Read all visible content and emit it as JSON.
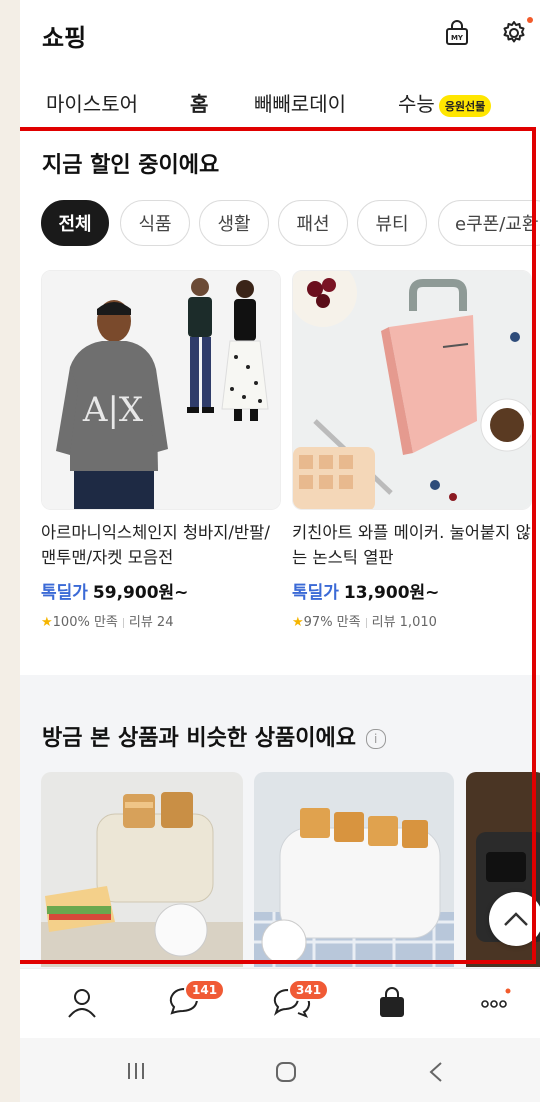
{
  "header": {
    "title": "쇼핑",
    "my_icon_text": "MY"
  },
  "top_tabs": [
    {
      "label": "마이스토어"
    },
    {
      "label": "홈"
    },
    {
      "label": "빼빼로데이"
    },
    {
      "label": "수능",
      "badge": "응원선물"
    }
  ],
  "deals": {
    "title": "지금 할인 중이에요",
    "chips": [
      "전체",
      "식품",
      "생활",
      "패션",
      "뷰티",
      "e쿠폰/교환"
    ],
    "products": [
      {
        "name": "아르마니익스체인지 청바지/반팔/맨투맨/자켓 모음전",
        "price_label": "톡딜가",
        "price": "59,900원~",
        "star": "★",
        "satisfaction": "100% 만족",
        "reviews": "리뷰 24"
      },
      {
        "name": "키친아트 와플 메이커. 눌어붙지 않는 논스틱 열판",
        "price_label": "톡딜가",
        "price": "13,900원~",
        "star": "★",
        "satisfaction": "97% 만족",
        "reviews": "리뷰 1,010"
      }
    ]
  },
  "similar": {
    "title": "방금 본 상품과 비슷한 상품이에요",
    "info_icon": "i"
  },
  "bottom_nav": {
    "chat_badge": "141",
    "open_chat_badge": "341",
    "more_label": "ooo"
  },
  "colors": {
    "accent_blue": "#3b6ad6",
    "badge_orange": "#f05a35",
    "badge_yellow": "#ffe600",
    "frame_red": "#e00000"
  },
  "icons": [
    "my-shopping-bag-icon",
    "gear-icon",
    "person-icon",
    "chat-bubble-icon",
    "open-chat-icon",
    "shopping-bag-icon",
    "more-icon",
    "chevron-up-icon",
    "recent-apps-icon",
    "home-icon",
    "back-icon"
  ]
}
